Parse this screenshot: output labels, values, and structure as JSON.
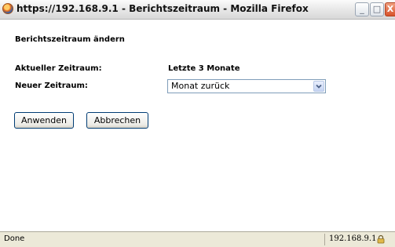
{
  "window": {
    "title": "https://192.168.9.1 - Berichtszeitraum - Mozilla Firefox",
    "buttons": {
      "minimize": "_",
      "maximize": "□",
      "close": "X"
    }
  },
  "dialog": {
    "heading": "Berichtszeitraum ändern",
    "current_period_label": "Aktueller Zeitraum:",
    "current_period_value": "Letzte 3 Monate",
    "new_period_label": "Neuer Zeitraum:",
    "new_period_selected": "Monat zurück",
    "apply_label": "Anwenden",
    "cancel_label": "Abbrechen"
  },
  "statusbar": {
    "status": "Done",
    "host": "192.168.9.1"
  },
  "icons": {
    "app": "firefox-icon",
    "dropdown": "chevron-down-icon",
    "secure": "lock-icon"
  }
}
